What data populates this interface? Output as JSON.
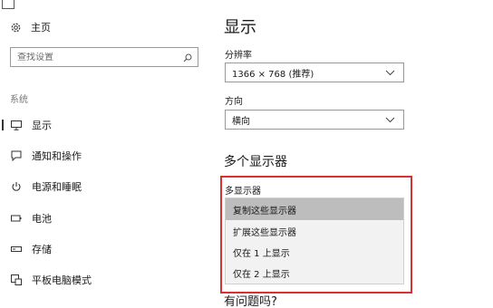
{
  "sidebar": {
    "home_label": "主页",
    "search_placeholder": "查找设置",
    "section_label": "系统",
    "items": [
      {
        "label": "显示",
        "icon": "monitor-icon",
        "active": true
      },
      {
        "label": "通知和操作",
        "icon": "notification-icon",
        "active": false
      },
      {
        "label": "电源和睡眠",
        "icon": "power-icon",
        "active": false
      },
      {
        "label": "电池",
        "icon": "battery-icon",
        "active": false
      },
      {
        "label": "存储",
        "icon": "storage-icon",
        "active": false
      },
      {
        "label": "平板电脑模式",
        "icon": "tablet-mode-icon",
        "active": false
      }
    ]
  },
  "main": {
    "title": "显示",
    "resolution": {
      "label": "分辨率",
      "value": "1366 × 768 (推荐)"
    },
    "orientation": {
      "label": "方向",
      "value": "横向"
    },
    "multi_display_heading": "多个显示器",
    "multi_display": {
      "label": "多显示器",
      "options": [
        "复制这些显示器",
        "扩展这些显示器",
        "仅在 1 上显示",
        "仅在 2 上显示"
      ],
      "selected_index": 0
    },
    "help_heading": "有问题吗?"
  },
  "colors": {
    "highlight_border": "#d93030",
    "selected_option_bg": "#bdbdbd",
    "dropdown_bg": "#f2f2f2"
  }
}
